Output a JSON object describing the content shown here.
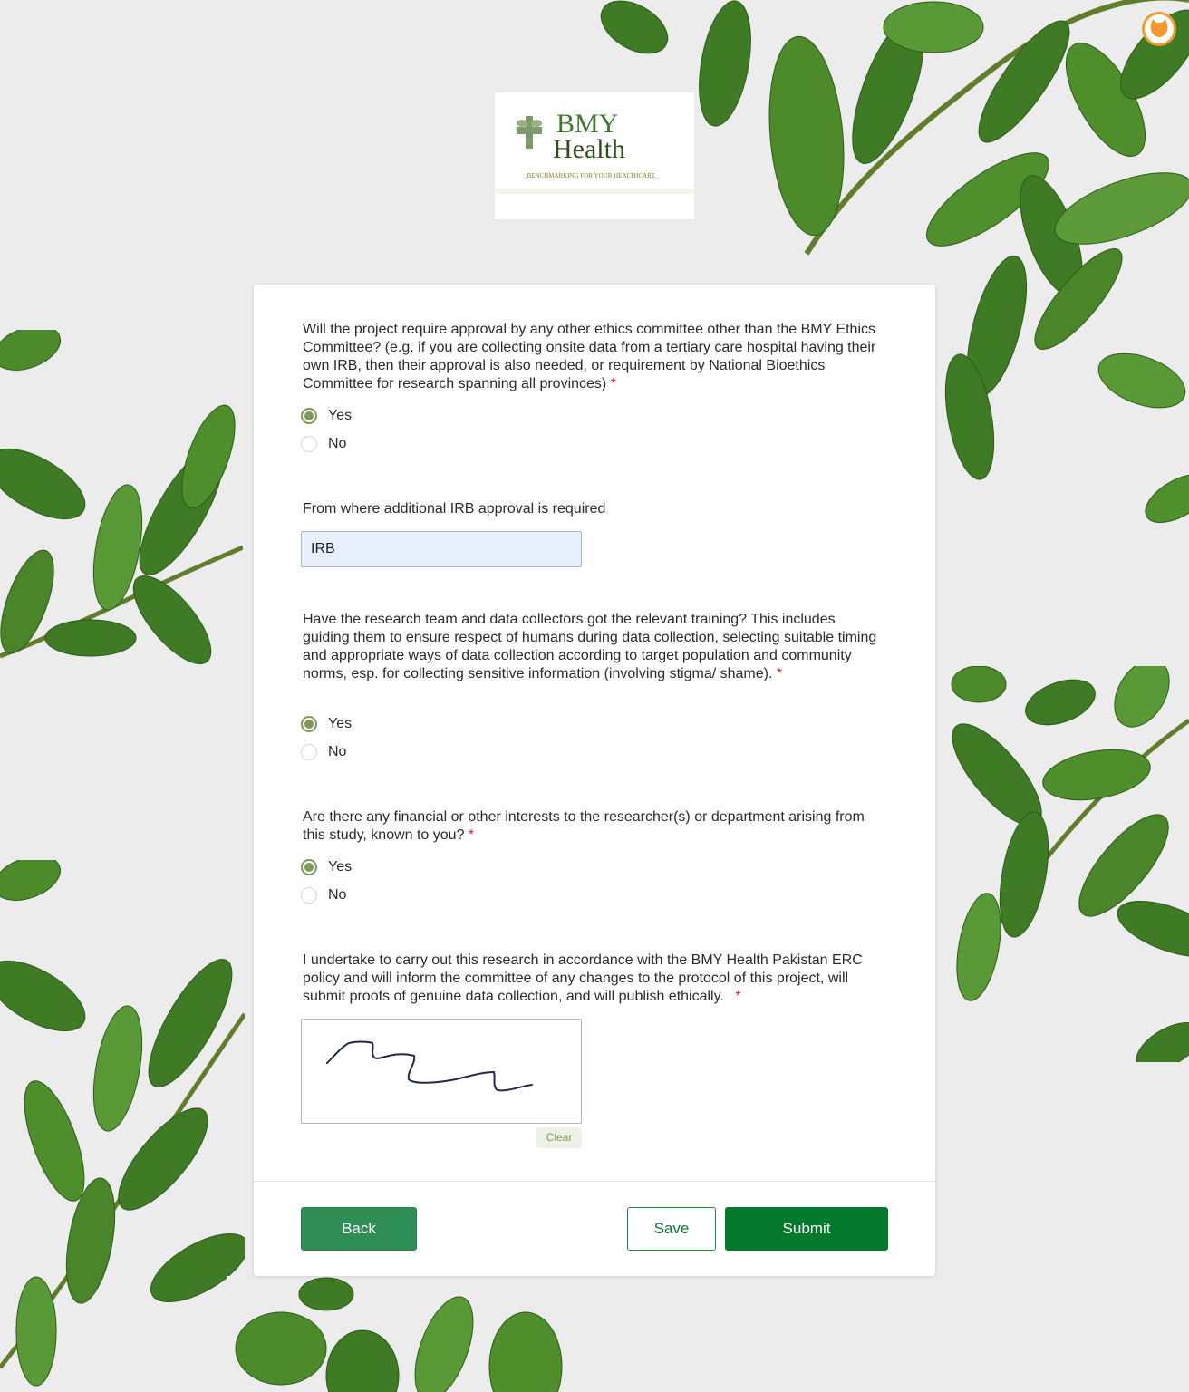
{
  "logo": {
    "line1": "BMY",
    "line2": "Health",
    "tagline": "_BENCHMARKING FOR YOUR HEALTHCARE_",
    "brand_color": "#3d7a2e"
  },
  "form": {
    "q1": {
      "text": "Will the project require approval by any other ethics committee other than the BMY Ethics Committee?  (e.g. if you are collecting onsite data from a tertiary care hospital having their own IRB, then their approval is also needed, or requirement by National Bioethics Committee for research spanning all provinces)",
      "required": "*",
      "options": [
        "Yes",
        "No"
      ],
      "selected": "Yes"
    },
    "q2": {
      "text": "From where additional IRB approval is required",
      "value": "IRB"
    },
    "q3": {
      "text": "Have the research team and data collectors got the relevant training? This includes guiding them to ensure respect of humans during data collection, selecting suitable timing and appropriate ways of data collection according to target population and community norms, esp. for collecting sensitive information (involving stigma/ shame).",
      "required": "*",
      "options": [
        "Yes",
        "No"
      ],
      "selected": "Yes"
    },
    "q4": {
      "text": "Are there any financial or other interests to the researcher(s) or department arising from this study, known to you?",
      "required": "*",
      "options": [
        "Yes",
        "No"
      ],
      "selected": "Yes"
    },
    "q5": {
      "text": "I undertake to carry out this research in accordance with the BMY Health Pakistan ERC policy and will inform the committee of any changes to the protocol of this project, will submit proofs of genuine data collection, and will publish ethically.",
      "required": "*",
      "clear_label": "Clear"
    }
  },
  "buttons": {
    "back": "Back",
    "save": "Save",
    "submit": "Submit"
  },
  "colors": {
    "accent_green": "#05792e",
    "radio_green": "#7e9a56",
    "required_red": "#d61f1f"
  },
  "icons": {
    "corner_badge": "cat-face-icon",
    "logo_mark": "cross-leaf-icon"
  }
}
